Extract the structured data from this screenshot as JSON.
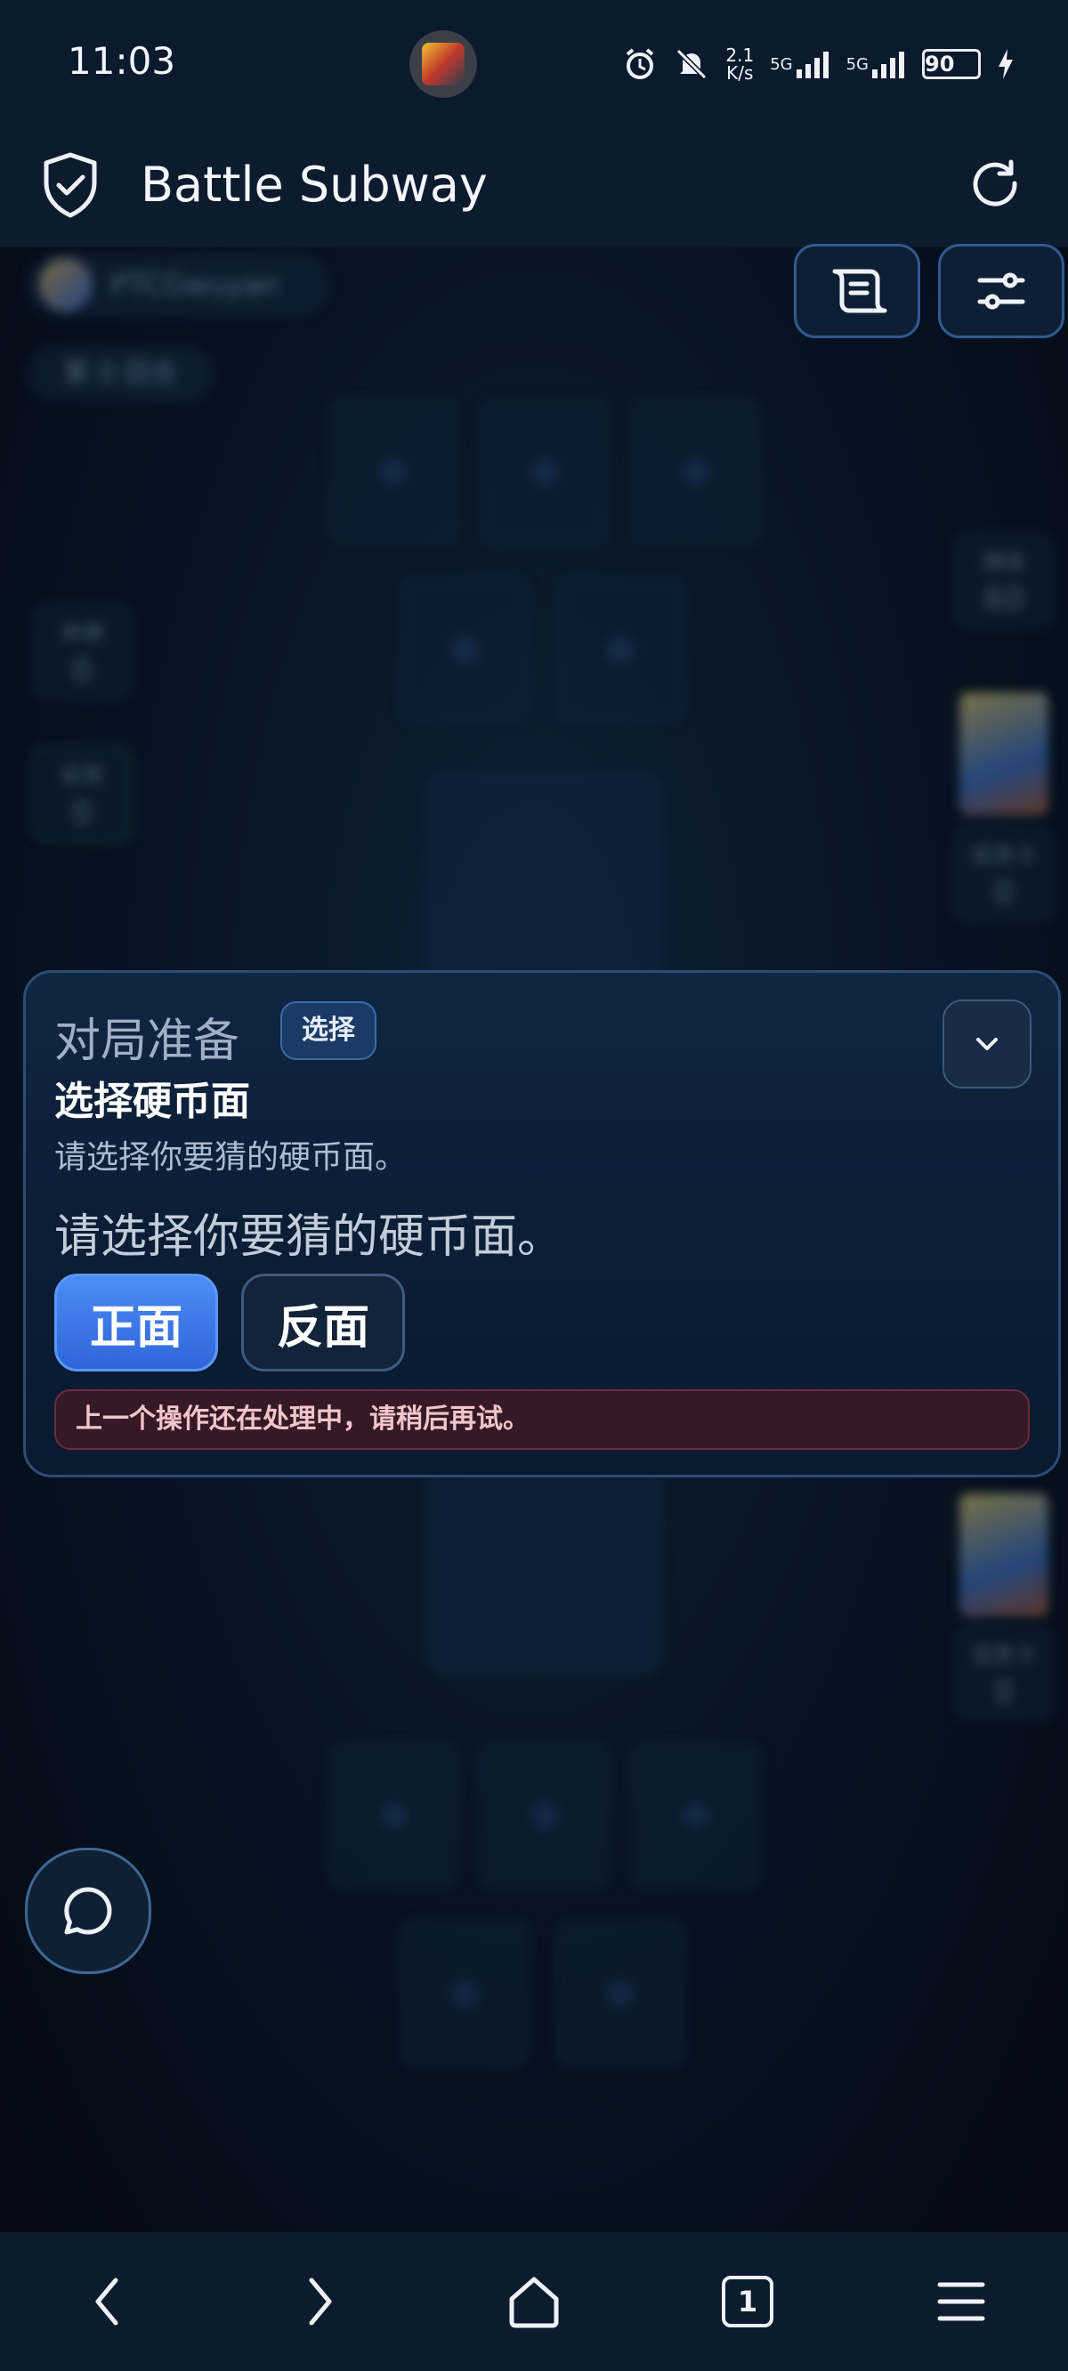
{
  "status_bar": {
    "time": "11:03",
    "net_speed_value": "2.1",
    "net_speed_unit": "K/s",
    "signal_1": "5G",
    "signal_2": "5G",
    "battery": "90"
  },
  "header": {
    "title": "Battle Subway",
    "logo_icon": "shield-check-icon",
    "refresh_icon": "refresh-icon"
  },
  "board": {
    "player_name": "PTCGwuyan",
    "round_label": "第 0 回合",
    "left_stat_1": {
      "label": "弃牌",
      "value": "0"
    },
    "left_stat_2": {
      "label": "奖赏",
      "value": "0"
    },
    "right_stat_1": {
      "label": "牌库",
      "value": "60"
    },
    "right_stat_2": {
      "label": "奖赏卡",
      "value": "0"
    },
    "right_stat_3": {
      "label": "奖赏卡",
      "value": "0"
    }
  },
  "toolbar": {
    "log_icon": "scroll-icon",
    "settings_icon": "sliders-icon"
  },
  "prompt": {
    "heading": "对局准备",
    "badge": "选择",
    "subtitle": "选择硬币面",
    "description": "请选择你要猜的硬币面。",
    "question": "请选择你要猜的硬币面。",
    "heads_label": "正面",
    "tails_label": "反面",
    "error": "上一个操作还在处理中，请稍后再试。",
    "collapse_icon": "chevron-down-icon"
  },
  "chat": {
    "icon": "chat-bubble-icon"
  },
  "nav": {
    "back_icon": "chevron-left-icon",
    "forward_icon": "chevron-right-icon",
    "home_icon": "home-icon",
    "tabs_count": "1",
    "menu_icon": "menu-icon"
  }
}
